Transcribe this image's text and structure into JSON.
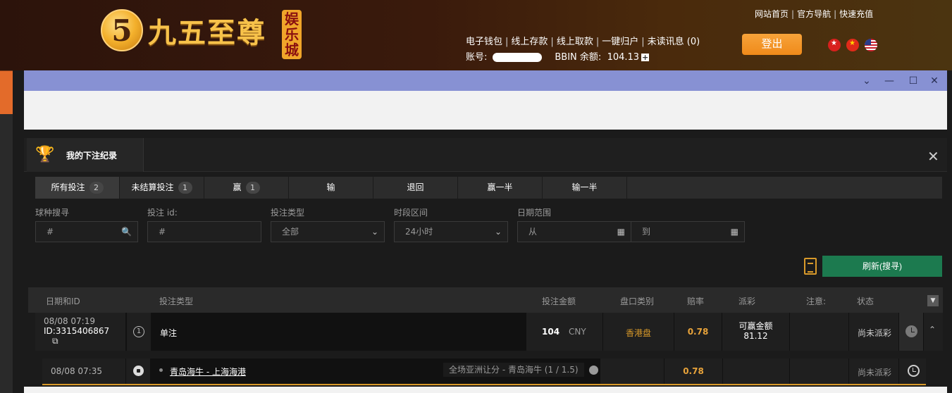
{
  "header": {
    "logo_number": "5",
    "logo_text": "九五至尊",
    "logo_badge": "娱乐城",
    "top_links": [
      "网站首页",
      "官方导航",
      "快速充值"
    ],
    "account_links": [
      "电子钱包",
      "线上存款",
      "线上取款",
      "一键归户",
      "未读讯息 (0)"
    ],
    "account_label": "账号:",
    "balance_label": "BBIN 余额:",
    "balance_value": "104.13",
    "logout_label": "登出"
  },
  "panel": {
    "title": "我的下注纪录",
    "tabs": [
      {
        "label": "所有投注",
        "count": "2"
      },
      {
        "label": "未结算投注",
        "count": "1"
      },
      {
        "label": "赢",
        "count": "1"
      },
      {
        "label": "输",
        "count": ""
      },
      {
        "label": "退回",
        "count": ""
      },
      {
        "label": "赢一半",
        "count": ""
      },
      {
        "label": "输一半",
        "count": ""
      }
    ],
    "filters": {
      "sport_label": "球种搜寻",
      "sport_placeholder": "#",
      "betid_label": "投注 id:",
      "betid_placeholder": "#",
      "bettype_label": "投注类型",
      "bettype_value": "全部",
      "period_label": "时段区间",
      "period_value": "24小时",
      "daterange_label": "日期范围",
      "from_placeholder": "从",
      "to_placeholder": "到"
    },
    "refresh_label": "刷新(搜寻)",
    "columns": [
      "日期和ID",
      "投注类型",
      "投注金额",
      "盘口类别",
      "赔率",
      "派彩",
      "注意:",
      "状态"
    ],
    "bet": {
      "date": "08/08 07:19",
      "id": "ID:3315406867",
      "legs": "1",
      "type": "单注",
      "amount": "104",
      "currency": "CNY",
      "odds_type": "香港盘",
      "odds": "0.78",
      "win_label": "可赢金额",
      "win_amount": "81.12",
      "status": "尚未派彩"
    },
    "leg": {
      "date": "08/08 07:35",
      "match": "青岛海牛 - 上海海港",
      "market": "全场亚洲让分 - 青岛海牛 (1 / 1.5)",
      "odds": "0.78",
      "status": "尚未派彩"
    }
  }
}
